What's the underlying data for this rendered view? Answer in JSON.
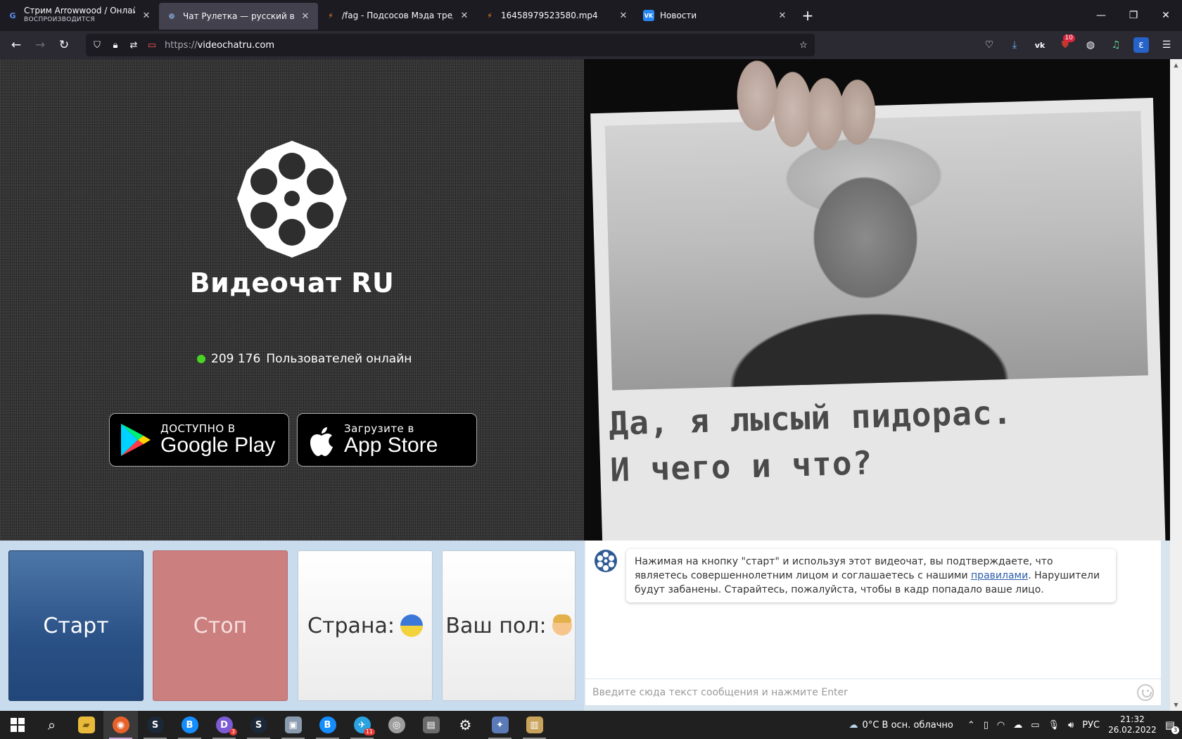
{
  "browser": {
    "tabs": [
      {
        "title": "Стрим Arrowwood / Онлайн-т",
        "subtitle": "ВОСПРОИЗВОДИТСЯ",
        "favicon": "G",
        "favicon_color": "#5b8dee"
      },
      {
        "title": "Чат Рулетка — русский видео",
        "subtitle": "",
        "favicon": "❁",
        "favicon_color": "#3d6fb6"
      },
      {
        "title": "/fag - Подсосов Мэда тред №",
        "subtitle": "",
        "favicon": "⚡",
        "favicon_color": "#f08a24"
      },
      {
        "title": "16458979523580.mp4",
        "subtitle": "",
        "favicon": "⚡",
        "favicon_color": "#f08a24"
      },
      {
        "title": "Новости",
        "subtitle": "",
        "favicon": "VK",
        "favicon_color": "#2787f5"
      }
    ],
    "new_tab": "+",
    "window_controls": {
      "minimize": "—",
      "maximize": "❐",
      "close": "✕"
    },
    "nav": {
      "back": "←",
      "forward": "→",
      "reload": "↻"
    },
    "url_scheme": "https://",
    "url_host": "videochatru.com",
    "bookmark_star": "☆",
    "toolbar_icons": [
      {
        "name": "pocket-icon",
        "glyph": "♡",
        "badge": ""
      },
      {
        "name": "download-icon",
        "glyph": "⤓",
        "badge": ""
      },
      {
        "name": "vk-extension-icon",
        "glyph": "vk",
        "badge": ""
      },
      {
        "name": "ublock-icon",
        "glyph": "⛊",
        "badge": "10"
      },
      {
        "name": "globe-icon",
        "glyph": "◍",
        "badge": ""
      },
      {
        "name": "music-icon",
        "glyph": "♫",
        "badge": ""
      },
      {
        "name": "translate-icon",
        "glyph": "ε",
        "badge": ""
      },
      {
        "name": "menu-icon",
        "glyph": "☰",
        "badge": ""
      }
    ]
  },
  "site": {
    "brand_name": "Видеочат RU",
    "online_count": "209 176",
    "online_label": "Пользователей онлайн",
    "google_play": {
      "small": "ДОСТУПНО В",
      "big": "Google Play"
    },
    "app_store": {
      "small": "Загрузите в",
      "big": "App Store"
    },
    "partner_sign_line1": "Да, я лысый пидорас.",
    "partner_sign_line2": "И чего и что?",
    "buttons": {
      "start": "Старт",
      "stop": "Стоп",
      "country": "Страна:",
      "gender": "Ваш пол:"
    },
    "chat": {
      "notice_part1": "Нажимая на кнопку \"старт\" и используя этот видеочат, вы подтверждаете, что являетесь совершеннолетним лицом и соглашаетесь с нашими ",
      "notice_link": "правилами",
      "notice_part2": ". Нарушители будут забанены. Старайтесь, пожалуйста, чтобы в кадр попадало ваше лицо.",
      "input_placeholder": "Введите сюда текст сообщения и нажмите Enter"
    },
    "colors": {
      "online_dot": "#49d325",
      "start": "#2a5186",
      "stop": "#cc7f7f"
    }
  },
  "taskbar": {
    "apps": [
      {
        "name": "start-menu-icon",
        "glyph": "⊞",
        "bg": "transparent",
        "badge": "",
        "active": false
      },
      {
        "name": "search-icon",
        "glyph": "⌕",
        "bg": "transparent",
        "badge": "",
        "active": false
      },
      {
        "name": "file-explorer-icon",
        "glyph": "▰",
        "bg": "#e8b93a",
        "badge": "",
        "active": false
      },
      {
        "name": "firefox-icon",
        "glyph": "◉",
        "bg": "#e6622a",
        "badge": "",
        "active": true
      },
      {
        "name": "steam-icon",
        "glyph": "S",
        "bg": "#1b2838",
        "badge": "",
        "active": false
      },
      {
        "name": "battlenet-icon",
        "glyph": "B",
        "bg": "#148eff",
        "badge": "",
        "active": false
      },
      {
        "name": "discord-icon",
        "glyph": "D",
        "bg": "#7b5cd6",
        "badge": "3",
        "active": false
      },
      {
        "name": "steam-2-icon",
        "glyph": "S",
        "bg": "#1b2838",
        "badge": "",
        "active": false
      },
      {
        "name": "image-viewer-icon",
        "glyph": "▣",
        "bg": "#8a9bb0",
        "badge": "",
        "active": false
      },
      {
        "name": "battlenet-2-icon",
        "glyph": "B",
        "bg": "#148eff",
        "badge": "",
        "active": false
      },
      {
        "name": "telegram-icon",
        "glyph": "✈",
        "bg": "#2aa3e0",
        "badge": "11",
        "active": false
      },
      {
        "name": "disc-icon",
        "glyph": "◎",
        "bg": "#9e9e9e",
        "badge": "",
        "active": false
      },
      {
        "name": "installer-icon",
        "glyph": "▤",
        "bg": "#6b6b6b",
        "badge": "",
        "active": false
      },
      {
        "name": "settings-icon",
        "glyph": "⚙",
        "bg": "transparent",
        "badge": "",
        "active": false
      },
      {
        "name": "app-icon",
        "glyph": "✦",
        "bg": "#5a7bb8",
        "badge": "",
        "active": false
      },
      {
        "name": "tool-icon",
        "glyph": "▥",
        "bg": "#c9a25b",
        "badge": "",
        "active": false
      }
    ],
    "weather": "0°C  В осн. облачно",
    "language": "РУС",
    "time": "21:32",
    "date": "26.02.2022",
    "notifications": "3"
  }
}
